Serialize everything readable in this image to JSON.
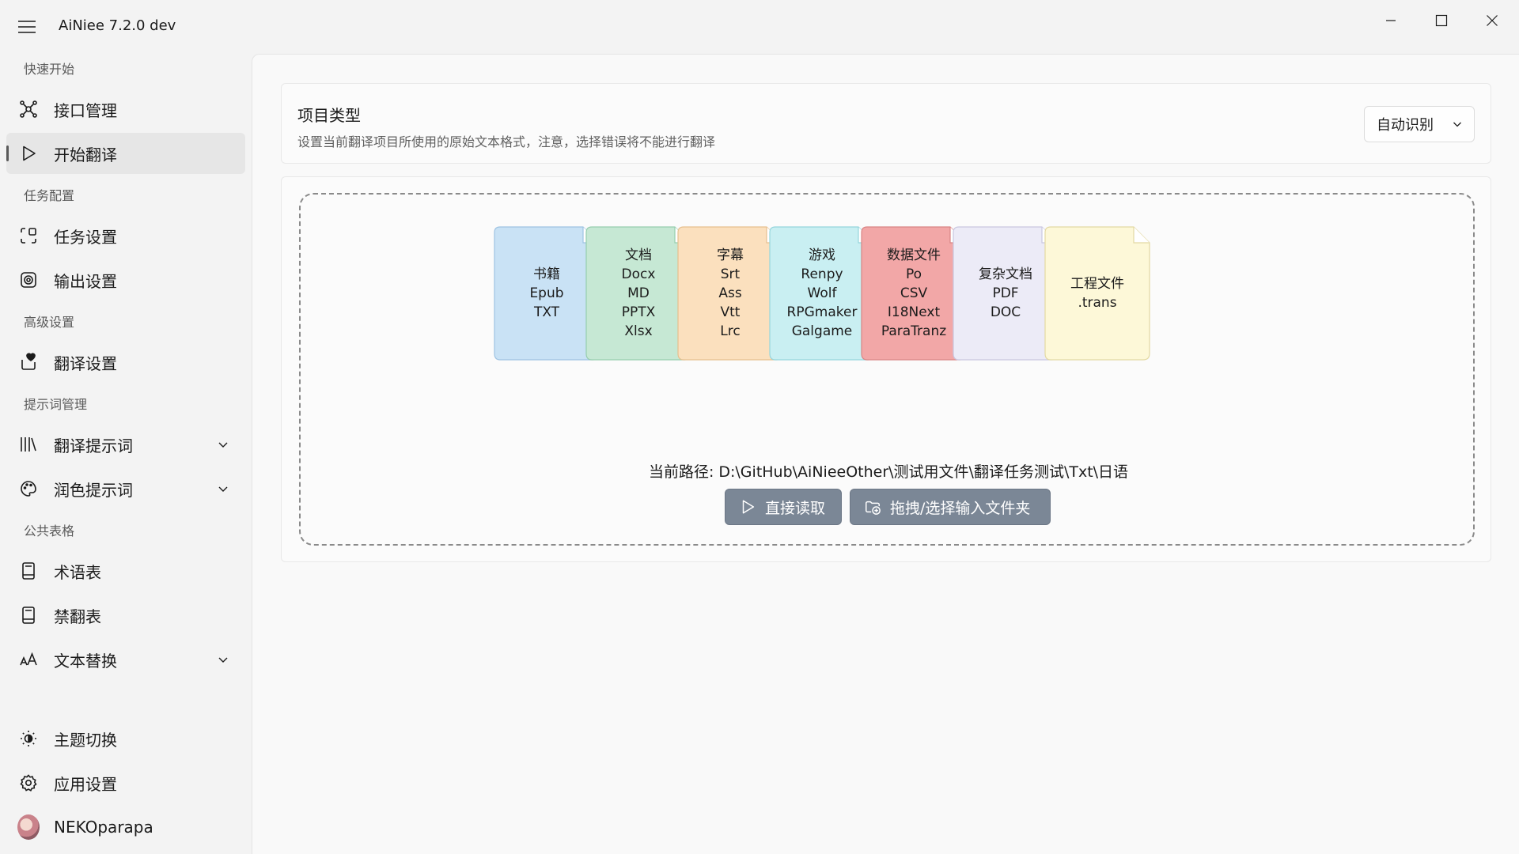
{
  "app": {
    "title": "AiNiee 7.2.0 dev"
  },
  "sidebar": {
    "sections": [
      {
        "label": "快速开始"
      },
      {
        "label": "任务配置"
      },
      {
        "label": "高级设置"
      },
      {
        "label": "提示词管理"
      },
      {
        "label": "公共表格"
      }
    ],
    "items": [
      {
        "label": "接口管理",
        "icon": "network-icon"
      },
      {
        "label": "开始翻译",
        "icon": "play-icon",
        "active": true
      },
      {
        "label": "任务设置",
        "icon": "task-settings-icon"
      },
      {
        "label": "输出设置",
        "icon": "output-icon"
      },
      {
        "label": "翻译设置",
        "icon": "heart-settings-icon"
      },
      {
        "label": "翻译提示词",
        "icon": "library-icon",
        "expandable": true
      },
      {
        "label": "润色提示词",
        "icon": "palette-icon",
        "expandable": true
      },
      {
        "label": "术语表",
        "icon": "book-icon"
      },
      {
        "label": "禁翻表",
        "icon": "book-icon"
      },
      {
        "label": "文本替换",
        "icon": "font-size-icon",
        "expandable": true
      }
    ],
    "bottom_items": [
      {
        "label": "主题切换",
        "icon": "brightness-icon"
      },
      {
        "label": "应用设置",
        "icon": "gear-icon"
      },
      {
        "label": "NEKOparapa",
        "icon": "avatar"
      }
    ]
  },
  "project_type": {
    "title": "项目类型",
    "subtitle": "设置当前翻译项目所使用的原始文本格式，注意，选择错误将不能进行翻译",
    "selected": "自动识别"
  },
  "file_types": [
    {
      "lines": [
        "书籍",
        "Epub",
        "TXT"
      ],
      "color": "#c9e2f5",
      "border": "#9ec3e2"
    },
    {
      "lines": [
        "文档",
        "Docx",
        "MD",
        "PPTX",
        "Xlsx"
      ],
      "color": "#c6e8d4",
      "border": "#96cdae"
    },
    {
      "lines": [
        "字幕",
        "Srt",
        "Ass",
        "Vtt",
        "Lrc"
      ],
      "color": "#fbe0be",
      "border": "#e6bf8e"
    },
    {
      "lines": [
        "游戏",
        "Renpy",
        "Wolf",
        "RPGmaker",
        "Galgame"
      ],
      "color": "#c9eff2",
      "border": "#95d5dc"
    },
    {
      "lines": [
        "数据文件",
        "Po",
        "CSV",
        "I18Next",
        "ParaTranz"
      ],
      "color": "#f2a7a7",
      "border": "#d98585"
    },
    {
      "lines": [
        "复杂文档",
        "PDF",
        "DOC"
      ],
      "color": "#ecebf7",
      "border": "#c9c7e0"
    },
    {
      "lines": [
        "工程文件",
        ".trans"
      ],
      "color": "#fdf8d8",
      "border": "#e3d9a3"
    }
  ],
  "drop": {
    "path_text": "当前路径: D:\\GitHub\\AiNieeOther\\测试用文件\\翻译任务测试\\Txt\\日语",
    "read_button": "直接读取",
    "pick_button": "拖拽/选择输入文件夹"
  },
  "colors": {
    "button_bg": "#7b8796",
    "active_nav": "#e6e6e6"
  }
}
